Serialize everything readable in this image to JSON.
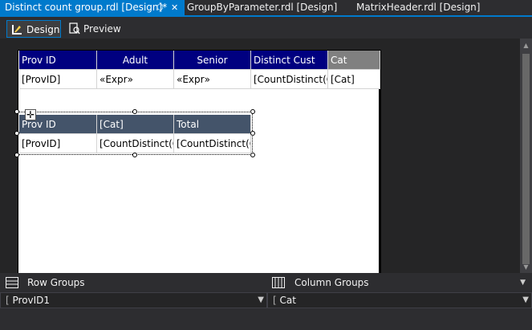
{
  "tabs": [
    {
      "label": "Distinct count group.rdl [Design]*",
      "pin": "⬡",
      "close": "✕"
    },
    {
      "label": "GroupByParameter.rdl [Design]"
    },
    {
      "label": "MatrixHeader.rdl [Design]"
    }
  ],
  "toolbar": {
    "design_label": "Design",
    "preview_label": "Preview"
  },
  "table1": {
    "headers": [
      "Prov ID",
      "Adult",
      "Senior",
      "Distinct Cust",
      "Cat"
    ],
    "row": [
      "[ProvID]",
      "«Expr»",
      "«Expr»",
      "[CountDistinct(C",
      "[Cat]"
    ]
  },
  "table2": {
    "headers": [
      "Prov ID",
      "[Cat]",
      "Total"
    ],
    "row": [
      "[ProvID]",
      "[CountDistinct(C",
      "[CountDistinct(C"
    ]
  },
  "groups": {
    "row_title": "Row Groups",
    "column_title": "Column Groups",
    "row_item": "ProvID1",
    "column_item": "Cat"
  },
  "colors": {
    "accent": "#007acc",
    "header_blue": "#000080",
    "header_grey": "#808080",
    "header_slate": "#44546a"
  }
}
